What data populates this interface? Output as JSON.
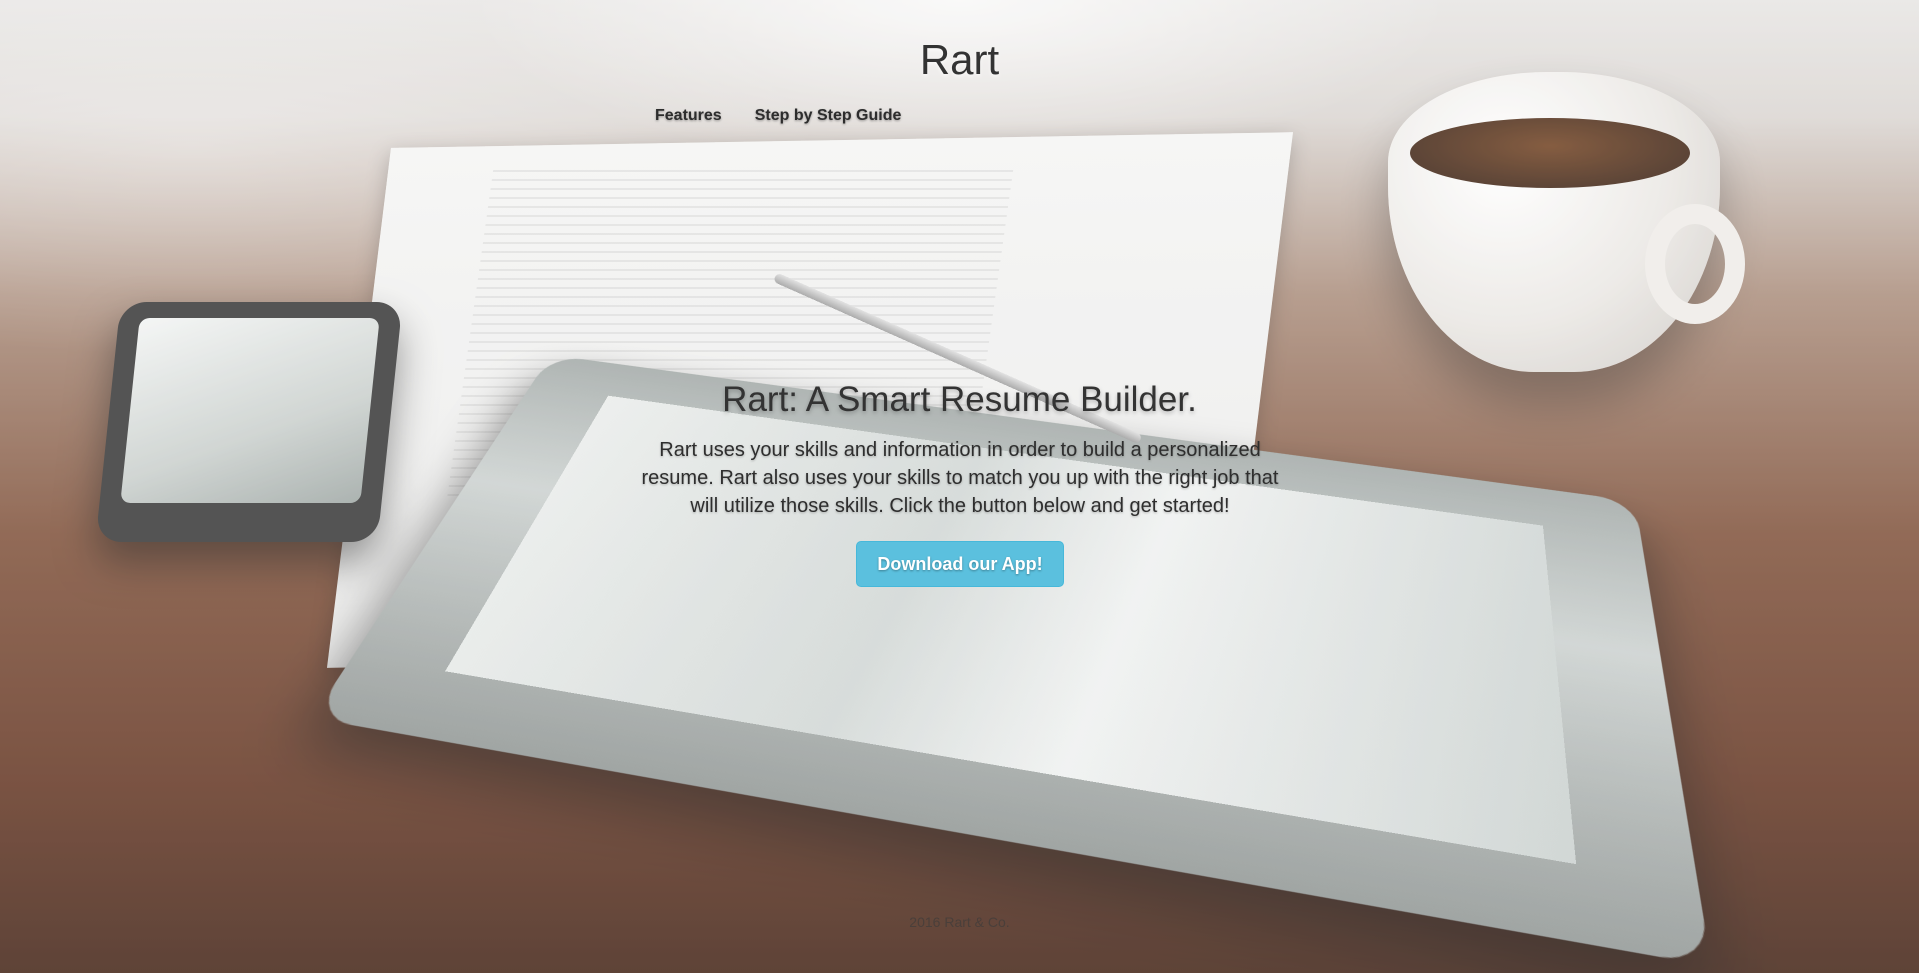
{
  "header": {
    "title": "Rart",
    "nav": [
      {
        "label": "Features"
      },
      {
        "label": "Step by Step Guide"
      }
    ]
  },
  "hero": {
    "title": "Rart: A Smart Resume Builder.",
    "description": "Rart uses your skills and information in order to build a personalized resume. Rart also uses your skills to match you up with the right job that will utilize those skills. Click the button below and get started!",
    "button_label": "Download our App!"
  },
  "footer": {
    "text": "2016 Rart & Co."
  },
  "colors": {
    "button": "#5bc0de",
    "title_text": "#333333"
  }
}
